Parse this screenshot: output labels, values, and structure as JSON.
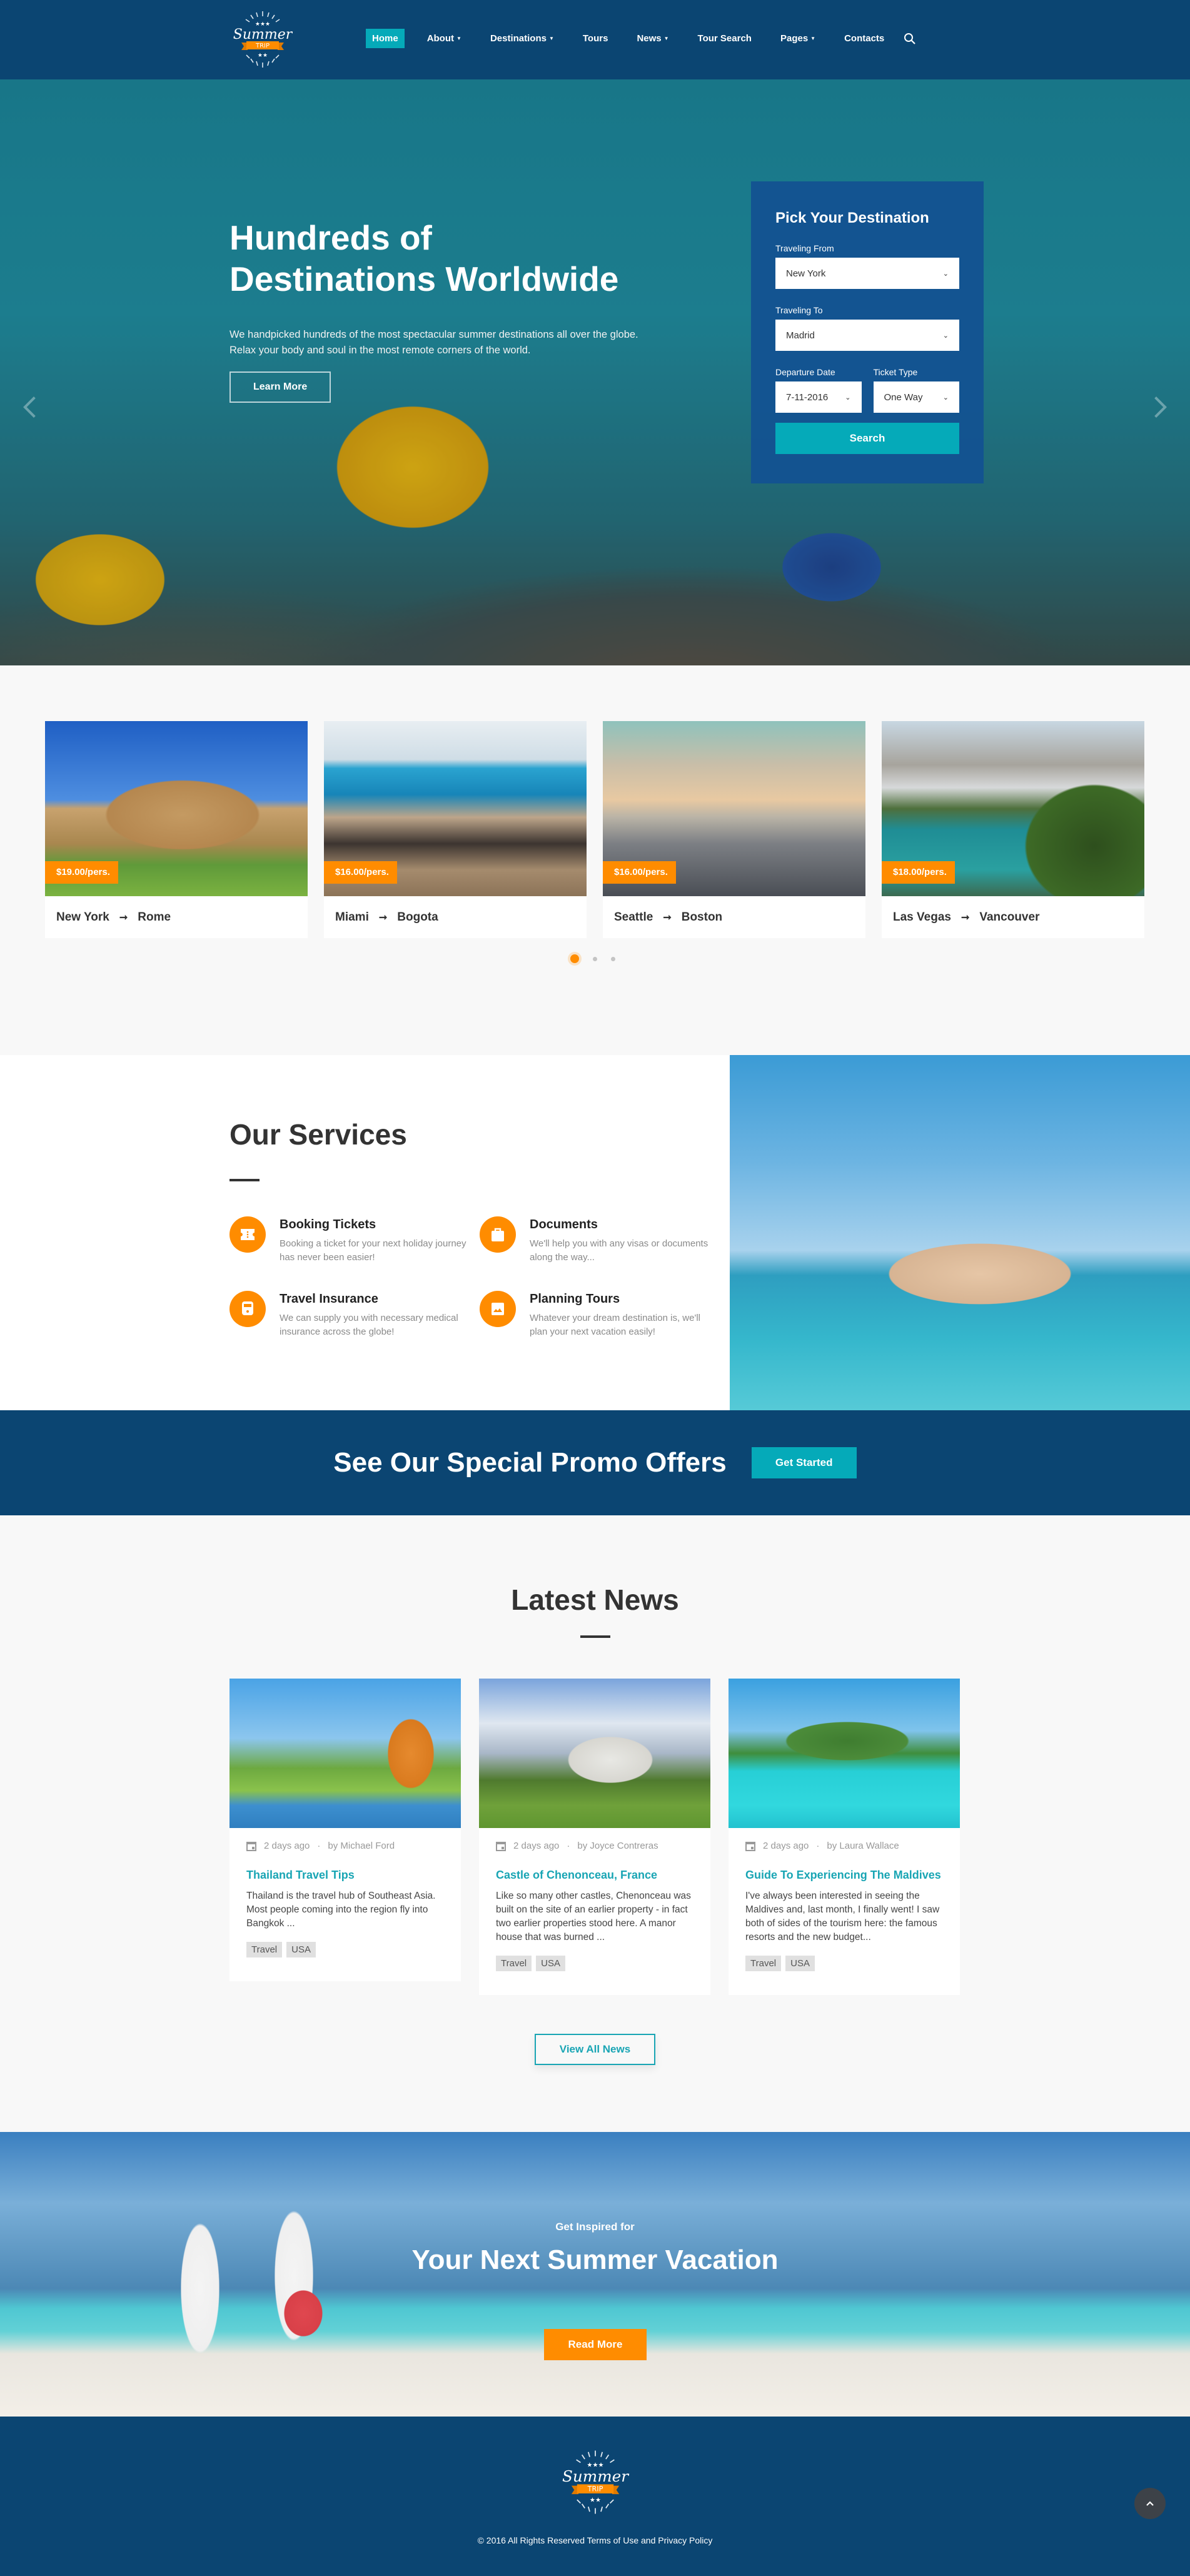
{
  "header": {
    "logo": {
      "word": "Summer",
      "badge": "TRIP"
    },
    "nav": [
      {
        "label": "Home",
        "active": true,
        "dropdown": false
      },
      {
        "label": "About",
        "dropdown": true
      },
      {
        "label": "Destinations",
        "dropdown": true
      },
      {
        "label": "Tours",
        "dropdown": false
      },
      {
        "label": "News",
        "dropdown": true
      },
      {
        "label": "Tour Search",
        "dropdown": false
      },
      {
        "label": "Pages",
        "dropdown": true
      },
      {
        "label": "Contacts",
        "dropdown": false
      }
    ],
    "search_icon": "search-icon"
  },
  "hero": {
    "title_line1": "Hundreds of",
    "title_line2": "Destinations Worldwide",
    "description": "We handpicked hundreds of the most spectacular summer destinations all over the globe. Relax your body and soul in the most remote corners of the world.",
    "cta": "Learn More",
    "prev_icon": "chevron-left-icon",
    "next_icon": "chevron-right-icon"
  },
  "booking": {
    "title": "Pick Your Destination",
    "from_label": "Traveling From",
    "from_value": "New York",
    "to_label": "Traveling To",
    "to_value": "Madrid",
    "date_label": "Departure Date",
    "date_value": "7-11-2016",
    "type_label": "Ticket Type",
    "type_value": "One Way",
    "submit": "Search"
  },
  "routes": {
    "cards": [
      {
        "from": "New York",
        "to": "Rome",
        "price": "$19.00/pers."
      },
      {
        "from": "Miami",
        "to": "Bogota",
        "price": "$16.00/pers."
      },
      {
        "from": "Seattle",
        "to": "Boston",
        "price": "$16.00/pers."
      },
      {
        "from": "Las Vegas",
        "to": "Vancouver",
        "price": "$18.00/pers."
      }
    ],
    "arrow": "➞",
    "pagination": {
      "pages": 3,
      "active": 1
    }
  },
  "services": {
    "title": "Our Services",
    "items": [
      {
        "name": "Booking Tickets",
        "desc": "Booking a ticket for your next holiday journey has never been easier!",
        "icon": "ticket-icon"
      },
      {
        "name": "Documents",
        "desc": "We'll help you with any visas or documents along the way...",
        "icon": "briefcase-icon"
      },
      {
        "name": "Travel Insurance",
        "desc": "We can supply you with necessary medical insurance across the globe!",
        "icon": "train-icon"
      },
      {
        "name": "Planning Tours",
        "desc": "Whatever your dream destination is, we'll plan your next vacation easily!",
        "icon": "image-icon"
      }
    ]
  },
  "promo": {
    "title": "See Our Special Promo Offers",
    "cta": "Get Started"
  },
  "news": {
    "title": "Latest News",
    "posts": [
      {
        "date": "2 days ago",
        "author": "by Michael Ford",
        "title": "Thailand Travel Tips",
        "excerpt": "Thailand is the travel hub of Southeast Asia. Most people coming into the region fly into Bangkok ...",
        "tags": [
          "Travel",
          "USA"
        ]
      },
      {
        "date": "2 days ago",
        "author": "by Joyce Contreras",
        "title": "Castle of Chenonceau, France",
        "excerpt": "Like so many other castles, Chenonceau was built on the site of an earlier property - in fact two earlier properties stood here. A manor house that was burned ...",
        "tags": [
          "Travel",
          "USA"
        ]
      },
      {
        "date": "2 days ago",
        "author": "by Laura Wallace",
        "title": "Guide To Experiencing The Maldives",
        "excerpt": "I've always been interested in seeing the Maldives and, last month, I finally went! I saw both of sides of the tourism here: the famous resorts and the new budget...",
        "tags": [
          "Travel",
          "USA"
        ]
      }
    ],
    "meta_sep": "·",
    "view_all": "View All News"
  },
  "inspire": {
    "subtitle": "Get Inspired for",
    "title": "Your Next Summer Vacation",
    "cta": "Read More"
  },
  "footer": {
    "copyright": "© 2016 All Rights Reserved",
    "terms": "Terms of Use",
    "and": "and",
    "privacy": "Privacy Policy",
    "to_top_icon": "chevron-up-icon"
  },
  "colors": {
    "navy": "#0b4572",
    "teal": "#05aab9",
    "orange": "#ff8c00",
    "link_teal": "#19a5b4"
  }
}
